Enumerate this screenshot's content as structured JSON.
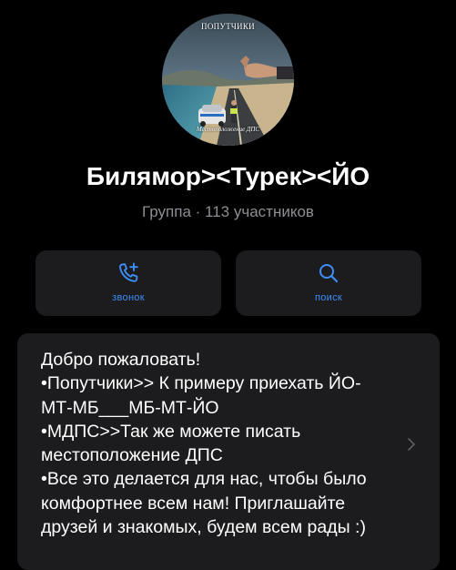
{
  "avatar": {
    "top_text": "ПОПУТЧИКИ",
    "bottom_text": "Местоположение ДПС"
  },
  "group": {
    "title": "Билямор><Турек><ЙО",
    "subtitle": "Группа · 113 участников"
  },
  "actions": {
    "call": {
      "label": "звонок",
      "icon": "phone-plus-icon"
    },
    "search": {
      "label": "поиск",
      "icon": "search-icon"
    }
  },
  "about": {
    "lines": [
      "Добро пожаловать!",
      "•Попутчики>> К примеру приехать ЙО-",
      "МТ-МБ___МБ-МТ-ЙО",
      "•МДПС>>Так же можете писать",
      "местоположение ДПС",
      "•Все это делается для нас, чтобы было",
      "комфортнее  всем нам! Приглашайте",
      "друзей и знакомых, будем всем рады :)"
    ]
  },
  "colors": {
    "background": "#000000",
    "card": "#1c1c1e",
    "accent": "#3d8ef8",
    "secondary_text": "#8d8d93"
  }
}
